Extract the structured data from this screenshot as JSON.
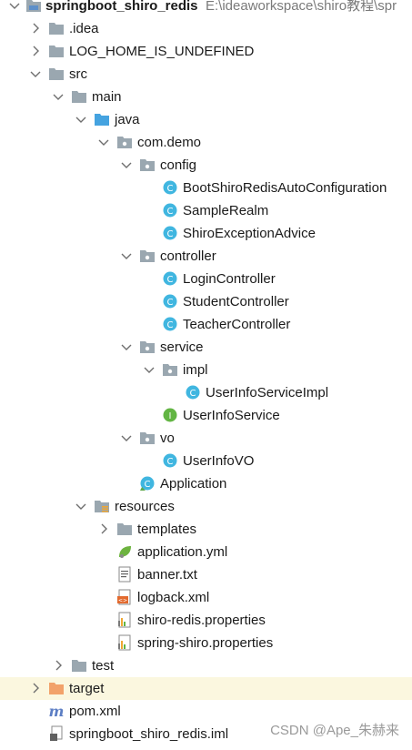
{
  "tree": {
    "root": {
      "label": "springboot_shiro_redis",
      "path": "E:\\ideaworkspace\\shiro教程\\spr"
    },
    "items": [
      {
        "label": "springboot_shiro_redis",
        "path": "E:\\ideaworkspace\\shiro教程\\spr",
        "kind": "module",
        "chevron": "down",
        "bold": true
      },
      {
        "label": ".idea",
        "kind": "folder",
        "chevron": "right"
      },
      {
        "label": "LOG_HOME_IS_UNDEFINED",
        "kind": "folder",
        "chevron": "right"
      },
      {
        "label": "src",
        "kind": "folder",
        "chevron": "down"
      },
      {
        "label": "main",
        "kind": "folder",
        "chevron": "down"
      },
      {
        "label": "java",
        "kind": "source-folder",
        "chevron": "down"
      },
      {
        "label": "com.demo",
        "kind": "package",
        "chevron": "down"
      },
      {
        "label": "config",
        "kind": "package",
        "chevron": "down"
      },
      {
        "label": "BootShiroRedisAutoConfiguration",
        "kind": "class"
      },
      {
        "label": "SampleRealm",
        "kind": "class"
      },
      {
        "label": "ShiroExceptionAdvice",
        "kind": "class"
      },
      {
        "label": "controller",
        "kind": "package",
        "chevron": "down"
      },
      {
        "label": "LoginController",
        "kind": "class"
      },
      {
        "label": "StudentController",
        "kind": "class"
      },
      {
        "label": "TeacherController",
        "kind": "class"
      },
      {
        "label": "service",
        "kind": "package",
        "chevron": "down"
      },
      {
        "label": "impl",
        "kind": "package",
        "chevron": "down"
      },
      {
        "label": "UserInfoServiceImpl",
        "kind": "class"
      },
      {
        "label": "UserInfoService",
        "kind": "interface"
      },
      {
        "label": "vo",
        "kind": "package",
        "chevron": "down"
      },
      {
        "label": "UserInfoVO",
        "kind": "class"
      },
      {
        "label": "Application",
        "kind": "spring-app"
      },
      {
        "label": "resources",
        "kind": "resources-folder",
        "chevron": "down"
      },
      {
        "label": "templates",
        "kind": "folder",
        "chevron": "right"
      },
      {
        "label": "application.yml",
        "kind": "yml"
      },
      {
        "label": "banner.txt",
        "kind": "text"
      },
      {
        "label": "logback.xml",
        "kind": "xml"
      },
      {
        "label": "shiro-redis.properties",
        "kind": "properties"
      },
      {
        "label": "spring-shiro.properties",
        "kind": "properties"
      },
      {
        "label": "test",
        "kind": "folder",
        "chevron": "right"
      },
      {
        "label": "target",
        "kind": "excluded-folder",
        "chevron": "right",
        "highlight": true
      },
      {
        "label": "pom.xml",
        "kind": "maven"
      },
      {
        "label": "springboot_shiro_redis.iml",
        "kind": "iml"
      }
    ]
  },
  "watermark": "CSDN @Ape_朱赫来",
  "colors": {
    "folder": "#9aa7b0",
    "class": "#40b6e0",
    "interface": "#62b543",
    "excluded_folder": "#f2a26a",
    "maven": "#5c7ec4",
    "highlight_row": "#fbf7df"
  }
}
